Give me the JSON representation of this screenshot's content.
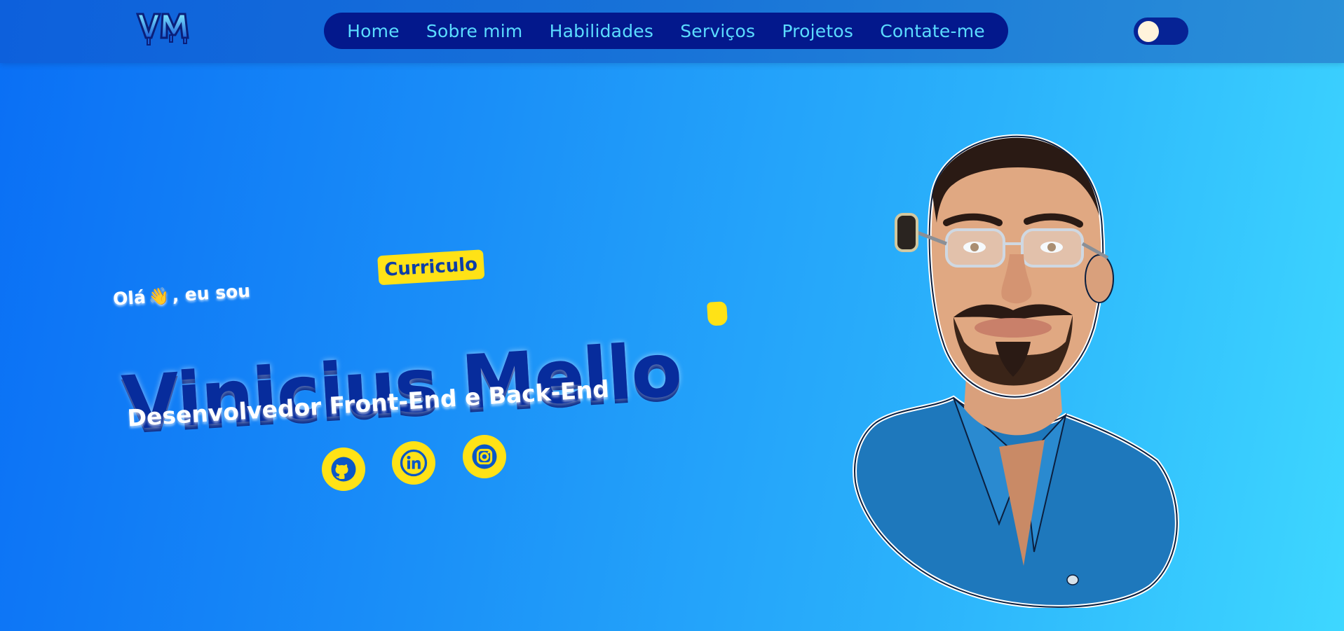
{
  "header": {
    "logo_text": "VM",
    "nav": [
      {
        "label": "Home"
      },
      {
        "label": "Sobre mim"
      },
      {
        "label": "Habilidades"
      },
      {
        "label": "Serviços"
      },
      {
        "label": "Projetos"
      },
      {
        "label": "Contate-me"
      }
    ],
    "theme_toggle": {
      "state": "light"
    }
  },
  "hero": {
    "greeting_prefix": "Olá",
    "greeting_emoji": "👋",
    "greeting_suffix": ", eu sou",
    "resume_button": "Curriculo",
    "name": "Vinicius Mello",
    "role": "Desenvolvedor Front-End e Back-End",
    "social_links": [
      {
        "icon": "github-icon"
      },
      {
        "icon": "linkedin-icon"
      },
      {
        "icon": "instagram-icon"
      }
    ]
  },
  "colors": {
    "accent_yellow": "#ffe216",
    "nav_background": "#03188c",
    "nav_text": "#5bdcff",
    "name_text": "#072c9c"
  }
}
